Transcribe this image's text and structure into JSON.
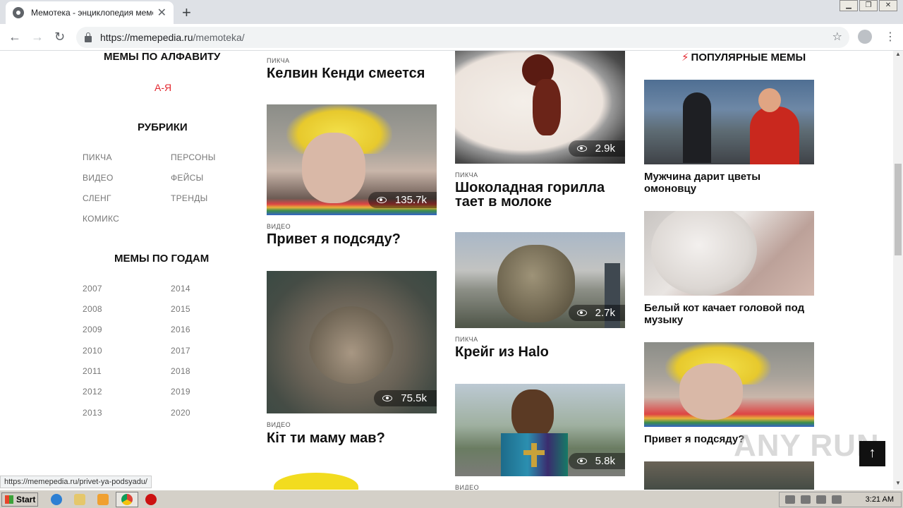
{
  "browser": {
    "tab_title": "Мемотека - энциклопедия мемов",
    "url_host": "https://memepedia.ru",
    "url_path": "/memoteka/",
    "status_url": "https://memepedia.ru/privet-ya-podsyadu/"
  },
  "sidebar": {
    "alphabet_heading": "МЕМЫ ПО АЛФАВИТУ",
    "alphabet_link": "А-Я",
    "rubrics_heading": "РУБРИКИ",
    "rubrics": [
      "ПИКЧА",
      "ПЕРСОНЫ",
      "ВИДЕО",
      "ФЕЙСЫ",
      "СЛЕНГ",
      "ТРЕНДЫ",
      "КОМИКС"
    ],
    "years_heading": "МЕМЫ ПО ГОДАМ",
    "years": [
      "2007",
      "2014",
      "2008",
      "2015",
      "2009",
      "2016",
      "2010",
      "2017",
      "2011",
      "2018",
      "2012",
      "2019",
      "2013",
      "2020"
    ]
  },
  "feed_col1": [
    {
      "category": "ПИКЧА",
      "title": "Келвин Кенди смеется"
    },
    {
      "views": "135.7k",
      "category": "ВИДЕО",
      "title": "Привет я подсяду?"
    },
    {
      "views": "75.5k",
      "category": "ВИДЕО",
      "title": "Кіт ти маму мав?"
    }
  ],
  "feed_col2": [
    {
      "views": "2.9k",
      "category": "ПИКЧА",
      "title": "Шоколадная горилла тает в молоке"
    },
    {
      "views": "2.7k",
      "category": "ПИКЧА",
      "title": "Крейг из Halo"
    },
    {
      "views": "5.8k",
      "category": "ВИДЕО"
    }
  ],
  "popular": {
    "heading": "ПОПУЛЯРНЫЕ МЕМЫ",
    "items": [
      {
        "title": "Мужчина дарит цветы омоновцу"
      },
      {
        "title": "Белый кот качает головой под музыку"
      },
      {
        "title": "Привет я подсяду?"
      }
    ]
  },
  "watermark": "ANY RUN",
  "taskbar": {
    "start_label": "Start",
    "time": "3:21 AM"
  }
}
